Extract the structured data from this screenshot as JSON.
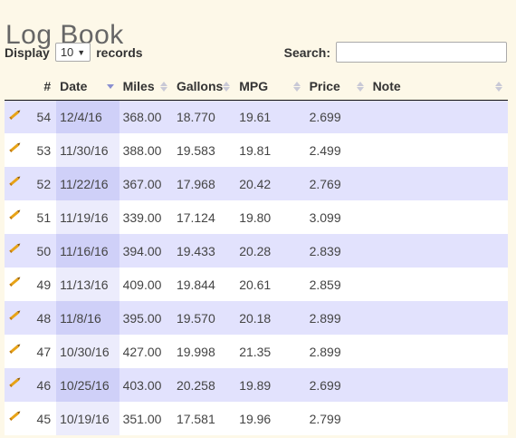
{
  "page": {
    "title": "Log Book"
  },
  "controls": {
    "display_label": "Display",
    "page_size": "10",
    "records_label": "records",
    "search_label": "Search:",
    "search_value": ""
  },
  "table": {
    "columns": [
      "#",
      "Date",
      "Miles",
      "Gallons",
      "MPG",
      "Price",
      "Note"
    ],
    "sorted_column": "Date",
    "sort_direction": "descending",
    "rows": [
      {
        "id": "54",
        "date": "12/4/16",
        "miles": "368.00",
        "gallons": "18.770",
        "mpg": "19.61",
        "price": "2.699",
        "note": ""
      },
      {
        "id": "53",
        "date": "11/30/16",
        "miles": "388.00",
        "gallons": "19.583",
        "mpg": "19.81",
        "price": "2.499",
        "note": ""
      },
      {
        "id": "52",
        "date": "11/22/16",
        "miles": "367.00",
        "gallons": "17.968",
        "mpg": "20.42",
        "price": "2.769",
        "note": ""
      },
      {
        "id": "51",
        "date": "11/19/16",
        "miles": "339.00",
        "gallons": "17.124",
        "mpg": "19.80",
        "price": "3.099",
        "note": ""
      },
      {
        "id": "50",
        "date": "11/16/16",
        "miles": "394.00",
        "gallons": "19.433",
        "mpg": "20.28",
        "price": "2.839",
        "note": ""
      },
      {
        "id": "49",
        "date": "11/13/16",
        "miles": "409.00",
        "gallons": "19.844",
        "mpg": "20.61",
        "price": "2.859",
        "note": ""
      },
      {
        "id": "48",
        "date": "11/8/16",
        "miles": "395.00",
        "gallons": "19.570",
        "mpg": "20.18",
        "price": "2.899",
        "note": ""
      },
      {
        "id": "47",
        "date": "10/30/16",
        "miles": "427.00",
        "gallons": "19.998",
        "mpg": "21.35",
        "price": "2.899",
        "note": ""
      },
      {
        "id": "46",
        "date": "10/25/16",
        "miles": "403.00",
        "gallons": "20.258",
        "mpg": "19.89",
        "price": "2.699",
        "note": ""
      },
      {
        "id": "45",
        "date": "10/19/16",
        "miles": "351.00",
        "gallons": "17.581",
        "mpg": "19.96",
        "price": "2.799",
        "note": ""
      }
    ]
  },
  "colors": {
    "background": "#fdf8e8",
    "row_odd": "#e2e2fd",
    "row_even": "#ffffff",
    "sorted_column_odd": "#cfd0f8",
    "sorted_column_even": "#ececfc",
    "pencil": "#e8a317",
    "sort_active": "#8a8fd0"
  },
  "icons": {
    "edit": "pencil-icon",
    "sort": "sort-arrows-icon"
  }
}
